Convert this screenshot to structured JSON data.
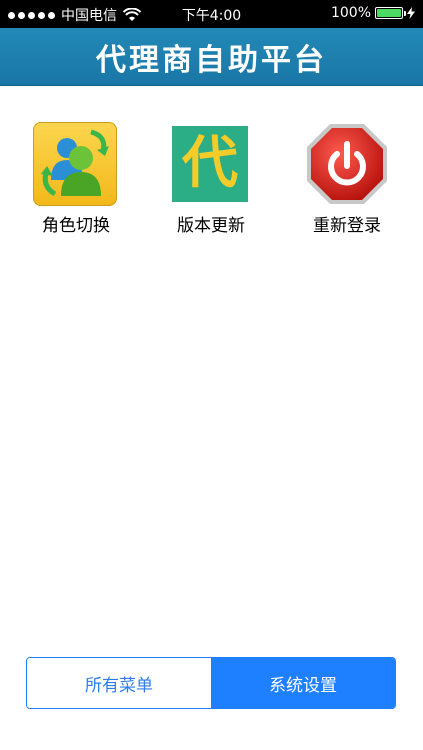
{
  "status": {
    "carrier": "中国电信",
    "time": "下午4:00",
    "battery": "100%"
  },
  "header": {
    "title": "代理商自助平台"
  },
  "grid": [
    {
      "label": "角色切换",
      "icon": "role-switch-icon"
    },
    {
      "label": "版本更新",
      "icon": "version-update-icon",
      "glyph": "代"
    },
    {
      "label": "重新登录",
      "icon": "power-icon"
    }
  ],
  "tabs": [
    {
      "label": "所有菜单",
      "active": false
    },
    {
      "label": "系统设置",
      "active": true
    }
  ],
  "colors": {
    "header_bg": "#1f82b2",
    "tab_active": "#1e7fff",
    "battery": "#4cd964"
  }
}
